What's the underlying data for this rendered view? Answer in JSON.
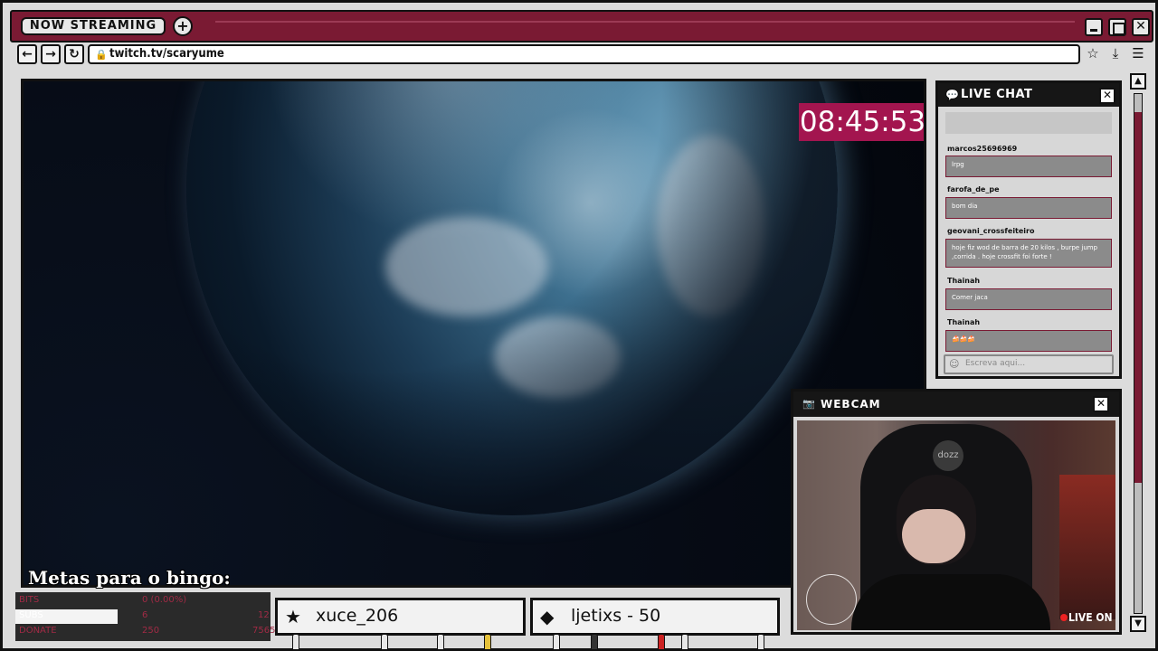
{
  "browser": {
    "tab_label": "NOW STREAMING",
    "new_tab_symbol": "+",
    "url": "twitch.tv/scaryume",
    "nav": {
      "back": "←",
      "forward": "→",
      "reload": "↻"
    },
    "window_controls": {
      "close_symbol": "✕"
    }
  },
  "stream": {
    "timer": "08:45:53"
  },
  "chat": {
    "title": "LIVE CHAT",
    "close_symbol": "✕",
    "input_placeholder": "Escreva aqui...",
    "messages": [
      {
        "user": "marcos25696969",
        "text": "lrpg"
      },
      {
        "user": "farofa_de_pe",
        "text": "bom dia"
      },
      {
        "user": "geovani_crossfeiteiro",
        "text": "hoje fiz wod de barra de 20 kilos , burpe jump ,corrida . hoje crossfit foi forte !"
      },
      {
        "user": "Thainah",
        "text": "Comer jaca"
      },
      {
        "user": "Thainah",
        "text": "🍰🍰🍰"
      }
    ]
  },
  "webcam": {
    "title": "WEBCAM",
    "close_symbol": "✕",
    "live_label": "LIVE ON",
    "chair_logo": "dozz"
  },
  "overlay": {
    "bingo_title": "Metas para o bingo:",
    "goals": [
      {
        "label": "BITS",
        "value": "0 (0.00%)",
        "target": "",
        "progress": 0
      },
      {
        "label": "SUBS",
        "value": "6",
        "target": "12",
        "progress": 0.4
      },
      {
        "label": "DONATE",
        "value": "250",
        "target": "7565",
        "progress": 0
      }
    ],
    "alerts": [
      {
        "icon": "star-icon",
        "text": "xuce_206"
      },
      {
        "icon": "diamond-icon",
        "text": "ljetixs - 50"
      }
    ]
  },
  "colors": {
    "accent": "#7a1a33",
    "timer_bg": "#a3154f",
    "panel_bg": "#d7d7d7"
  }
}
